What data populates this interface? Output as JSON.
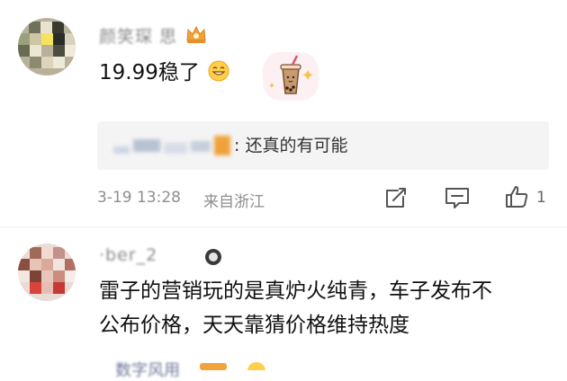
{
  "comments": [
    {
      "username": "颜笑琛 思",
      "content": "19.99稳了",
      "reply": {
        "username": "——————",
        "text": ": 还真的有可能"
      },
      "timestamp": "3-19 13:28",
      "location": "来自浙江",
      "like_count": "1"
    },
    {
      "username": "·ber_2 ",
      "content_line1": "雷子的营销玩的是真炉火纯青，车子发布不",
      "content_line2": "公布价格，天天靠猜价格维持热度"
    }
  ],
  "partial_next": "数字风用",
  "icons": {
    "crown": "crown-icon",
    "grin": "grin-emoji-icon",
    "sticker": "bubble-tea-sticker-icon",
    "reply_badge": "thumbs-up-badge-icon",
    "share": "repost-icon",
    "comment": "comment-icon",
    "like": "like-icon",
    "username_emoji": "emoji-icon"
  },
  "colors": {
    "crown": "#f0a23a",
    "meta_text": "#8e8e8e",
    "reply_bg": "#f4f4f4"
  }
}
